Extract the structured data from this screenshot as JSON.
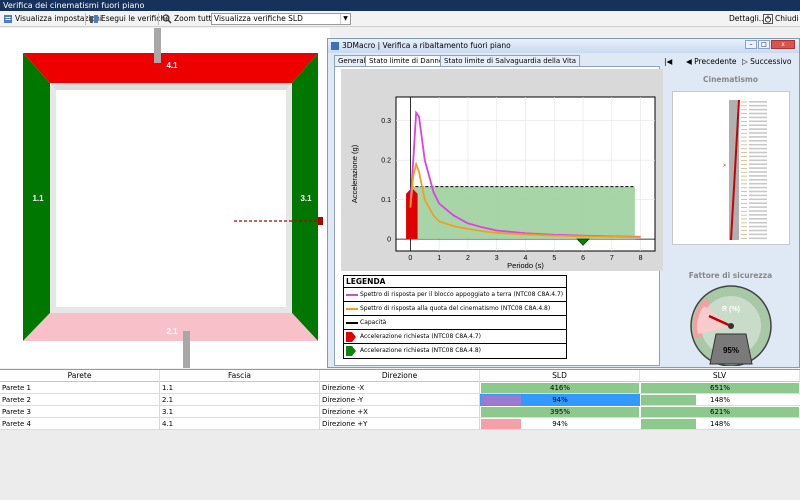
{
  "app": {
    "title": "Verifica dei cinematismi fuori piano"
  },
  "toolbar": {
    "settings": "Visualizza impostazioni",
    "run": "Esegui le verifiche",
    "zoom": "Zoom tutto",
    "combo_value": "Visualizza verifiche SLD",
    "details": "Dettagli...",
    "close": "Chiudi"
  },
  "walls": {
    "top": "4.1",
    "left": "1.1",
    "right": "3.1",
    "bottom": "2.1"
  },
  "dialog": {
    "title": "3DMacro | Verifica a ribaltamento fuori piano",
    "tabs": [
      "Generale",
      "Stato limite di Danno",
      "Stato limite di Salvaguardia della Vita"
    ]
  },
  "nav": {
    "prev": "Precedente",
    "next": "Successivo"
  },
  "right": {
    "cinematismo": "Cinematismo",
    "fattore": "Fattore di sicurezza",
    "gauge_label": "R (%)",
    "gauge_value": "95%"
  },
  "legend": {
    "title": "LEGENDA",
    "items": [
      {
        "label": "Spettro di risposta per il blocco appoggiato a terra (NTC08 C8A.4.7)",
        "color": "#e040e0"
      },
      {
        "label": "Spettro di risposta alla quota del cinematismo (NTC08 C8A.4.8)",
        "color": "#f0a020"
      },
      {
        "label": "Capacità",
        "color": "#000000"
      },
      {
        "label": "Accelerazione richiesta (NTC08 C8A.4.7)",
        "color": "#e00000"
      },
      {
        "label": "Accelerazione richiesta (NTC08 C8A.4.8)",
        "color": "#108010"
      }
    ]
  },
  "chart_data": {
    "type": "line",
    "xlabel": "Periodo (s)",
    "ylabel": "Accelerazione (g)",
    "xlim": [
      -0.5,
      8.5
    ],
    "ylim": [
      -0.03,
      0.36
    ],
    "xticks": [
      0,
      1,
      2,
      3,
      4,
      5,
      6,
      7,
      8
    ],
    "yticks": [
      0,
      0.1,
      0.2,
      0.3
    ],
    "capacity": 0.133,
    "capacity_range": [
      0,
      7.8
    ],
    "series": [
      {
        "name": "Spettro di risposta per il blocco appoggiato a terra (NTC08 C8A.4.7)",
        "color": "#e040e0",
        "x": [
          0,
          0.1,
          0.2,
          0.3,
          0.5,
          0.8,
          1,
          1.5,
          2,
          2.5,
          3,
          4,
          5,
          6,
          7,
          8
        ],
        "y": [
          0.09,
          0.2,
          0.32,
          0.31,
          0.2,
          0.12,
          0.09,
          0.06,
          0.04,
          0.03,
          0.022,
          0.015,
          0.011,
          0.009,
          0.007,
          0.006
        ]
      },
      {
        "name": "Spettro di risposta alla quota del cinematismo (NTC08 C8A.4.8)",
        "color": "#f0a020",
        "x": [
          0,
          0.1,
          0.2,
          0.3,
          0.5,
          0.8,
          1,
          1.5,
          2,
          2.5,
          3,
          4,
          5,
          6,
          7,
          8
        ],
        "y": [
          0.08,
          0.16,
          0.19,
          0.17,
          0.1,
          0.06,
          0.045,
          0.033,
          0.026,
          0.02,
          0.016,
          0.012,
          0.009,
          0.007,
          0.006,
          0.005
        ]
      }
    ]
  },
  "table": {
    "headers": [
      "Parete",
      "Fascia",
      "Direzione",
      "SLD",
      "SLV"
    ],
    "rows": [
      {
        "parete": "Parete 1",
        "fascia": "1.1",
        "direzione": "Direzione -X",
        "sld": "416%",
        "sld_frac": 1.0,
        "sld_color": "#8dc88d",
        "slv": "651%",
        "slv_frac": 1.0,
        "slv_color": "#8dc88d",
        "selected": false
      },
      {
        "parete": "Parete 2",
        "fascia": "2.1",
        "direzione": "Direzione -Y",
        "sld": "94%",
        "sld_frac": 0.25,
        "sld_color": "#9b7bd0",
        "slv": "148%",
        "slv_frac": 0.35,
        "slv_color": "#8dc88d",
        "selected": true
      },
      {
        "parete": "Parete 3",
        "fascia": "3.1",
        "direzione": "Direzione +X",
        "sld": "395%",
        "sld_frac": 1.0,
        "sld_color": "#8dc88d",
        "slv": "621%",
        "slv_frac": 1.0,
        "slv_color": "#8dc88d",
        "selected": false
      },
      {
        "parete": "Parete 4",
        "fascia": "4.1",
        "direzione": "Direzione +Y",
        "sld": "94%",
        "sld_frac": 0.25,
        "sld_color": "#f5a0a8",
        "slv": "148%",
        "slv_frac": 0.35,
        "slv_color": "#8dc88d",
        "selected": false
      }
    ]
  }
}
